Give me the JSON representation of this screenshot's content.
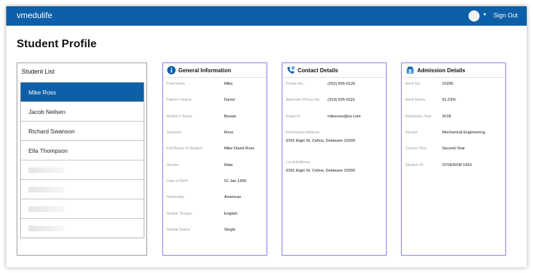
{
  "app": {
    "brand": "vmedulife",
    "sign_out": "Sign Out"
  },
  "page": {
    "title": "Student Profile"
  },
  "student_list": {
    "title": "Student List",
    "students": [
      "Mike Ross",
      "Jacob Neilsen",
      "Richard Swanson",
      "Ella Thompson"
    ],
    "selected": "Mike Ross"
  },
  "general": {
    "title": "General Information",
    "icon": "info-icon",
    "fields": [
      {
        "label": "First Name",
        "value": "Mike"
      },
      {
        "label": "Father's Name",
        "value": "David"
      },
      {
        "label": "Mother's Name",
        "value": "Bessie"
      },
      {
        "label": "Surname",
        "value": "Ross"
      },
      {
        "label": "Full Name of Student",
        "value": "Mike David Ross"
      },
      {
        "label": "Gender",
        "value": "Male"
      },
      {
        "label": "Date of Birth",
        "value": "01 Jan,1999"
      },
      {
        "label": "Nationality",
        "value": "American"
      },
      {
        "label": "Mother Tongue",
        "value": "English"
      },
      {
        "label": "Marital Status",
        "value": "Single"
      }
    ]
  },
  "contact": {
    "title": "Contact Details",
    "icon": "phone-icon",
    "phone_label": "Phone No.",
    "phone_value": "(252) 555-0126",
    "alt_phone_label": "Alternate Phone No.",
    "alt_phone_value": "(319) 555-0115",
    "email_label": "Email Id",
    "email_value": "mikeross@ex.com",
    "permanent_label": "Permanent Address",
    "permanent_value": "6391 Elgin St. Celina, Delaware 10299",
    "local_label": "Local Address",
    "local_value": "6391 Elgin St. Celina, Delaware 10299"
  },
  "admission": {
    "title": "Admission Details",
    "icon": "admission-icon",
    "fields": [
      {
        "label": "Merit No.",
        "value": "10295"
      },
      {
        "label": "Merit Marks",
        "value": "91.23%"
      },
      {
        "label": "Admission Year",
        "value": "2018"
      },
      {
        "label": "Stream",
        "value": "Mechanical Engineering"
      },
      {
        "label": "Current Year",
        "value": "Second Year"
      },
      {
        "label": "Student ID",
        "value": "STDENVM 1952"
      }
    ]
  },
  "colors": {
    "brand": "#0d5fa8",
    "card_border": "#8c89ef"
  }
}
